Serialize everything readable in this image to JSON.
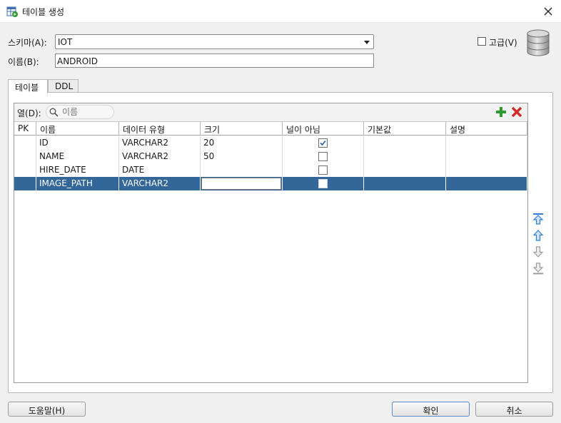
{
  "window": {
    "title": "테이블 생성"
  },
  "form": {
    "schema_label": "스키마(A):",
    "schema_value": "IOT",
    "name_label": "이름(B):",
    "name_value": "ANDROID",
    "advanced_label": "고급(V)",
    "advanced_checked": false
  },
  "tabs": [
    {
      "label": "테이블",
      "active": true
    },
    {
      "label": "DDL",
      "active": false
    }
  ],
  "columns_panel": {
    "label": "열(D):",
    "search_placeholder": "이름",
    "headers": [
      "PK",
      "이름",
      "데이터 유형",
      "크기",
      "널이 아님",
      "기본값",
      "설명"
    ],
    "rows": [
      {
        "pk": "",
        "name": "ID",
        "type": "VARCHAR2",
        "size": "20",
        "not_null": true,
        "default": "",
        "comment": ""
      },
      {
        "pk": "",
        "name": "NAME",
        "type": "VARCHAR2",
        "size": "50",
        "not_null": false,
        "default": "",
        "comment": ""
      },
      {
        "pk": "",
        "name": "HIRE_DATE",
        "type": "DATE",
        "size": "",
        "not_null": false,
        "default": "",
        "comment": ""
      },
      {
        "pk": "",
        "name": "IMAGE_PATH",
        "type": "VARCHAR2",
        "size": "",
        "not_null": false,
        "default": "",
        "comment": ""
      }
    ],
    "selected_row": 3
  },
  "buttons": {
    "help": "도움말(H)",
    "ok": "확인",
    "cancel": "취소"
  },
  "colors": {
    "selection": "#336699",
    "add_icon": "#2e9b2e",
    "delete_icon": "#d42a2a",
    "arrow_icon": "#2f7fd6"
  }
}
